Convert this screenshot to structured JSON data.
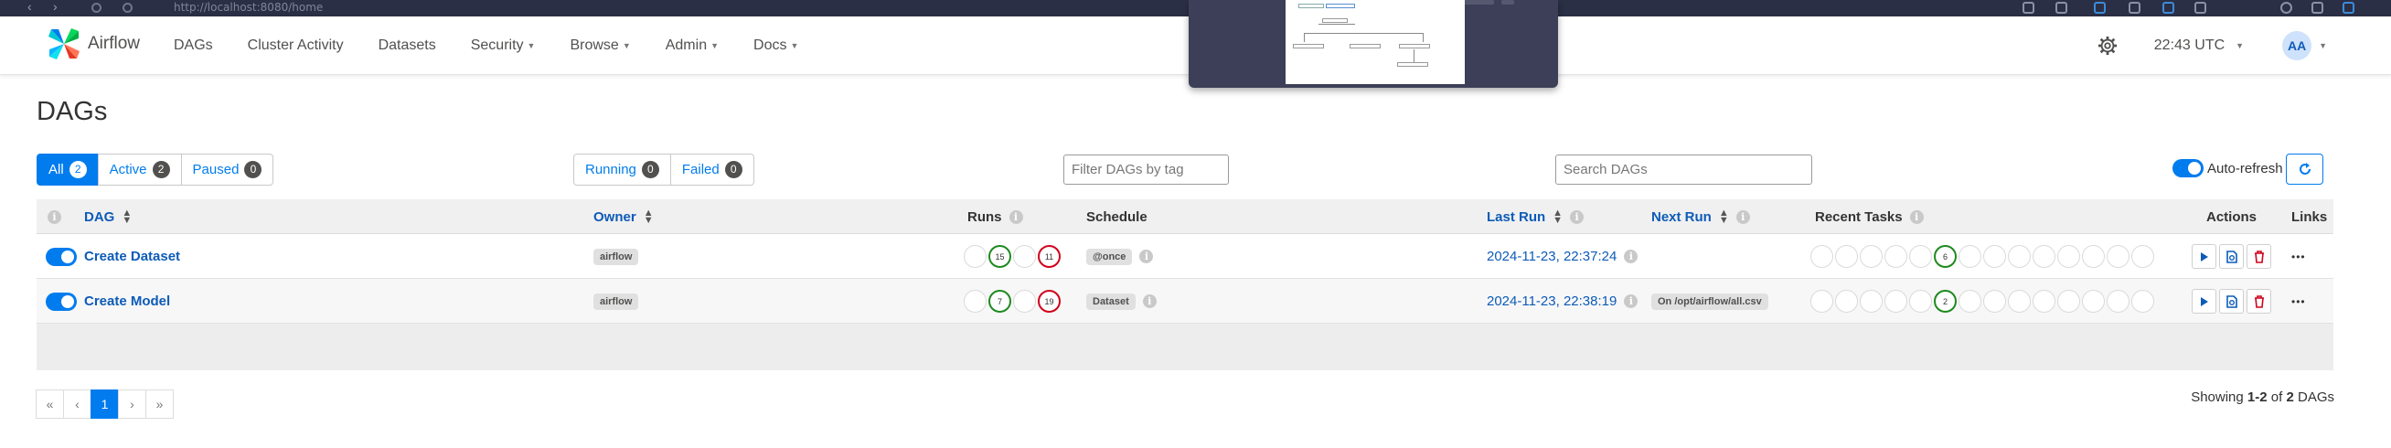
{
  "browser": {
    "url": "http://localhost:8080/home"
  },
  "brand": {
    "name": "Airflow"
  },
  "nav": {
    "items": [
      {
        "label": "DAGs",
        "dropdown": false
      },
      {
        "label": "Cluster Activity",
        "dropdown": false
      },
      {
        "label": "Datasets",
        "dropdown": false
      },
      {
        "label": "Security",
        "dropdown": true
      },
      {
        "label": "Browse",
        "dropdown": true
      },
      {
        "label": "Admin",
        "dropdown": true
      },
      {
        "label": "Docs",
        "dropdown": true
      }
    ],
    "time": "22:43 UTC",
    "avatar": "AA"
  },
  "page": {
    "title": "DAGs"
  },
  "status_filter": [
    {
      "label": "All",
      "count": "2",
      "active": true
    },
    {
      "label": "Active",
      "count": "2",
      "active": false
    },
    {
      "label": "Paused",
      "count": "0",
      "active": false
    }
  ],
  "run_filter": [
    {
      "label": "Running",
      "count": "0"
    },
    {
      "label": "Failed",
      "count": "0"
    }
  ],
  "tag_filter": {
    "placeholder": "Filter DAGs by tag"
  },
  "search": {
    "placeholder": "Search DAGs"
  },
  "auto_refresh": {
    "label": "Auto-refresh",
    "enabled": true
  },
  "table": {
    "headers": {
      "dag": "DAG",
      "owner": "Owner",
      "runs": "Runs",
      "schedule": "Schedule",
      "last_run": "Last Run",
      "next_run": "Next Run",
      "recent_tasks": "Recent Tasks",
      "actions": "Actions",
      "links": "Links"
    },
    "rows": [
      {
        "dag": "Create Dataset",
        "owner": "airflow",
        "runs_success": "15",
        "runs_failed": "11",
        "schedule": "@once",
        "last_run": "2024-11-23, 22:37:24",
        "next_run": "",
        "recent_success": "6"
      },
      {
        "dag": "Create Model",
        "owner": "airflow",
        "runs_success": "7",
        "runs_failed": "19",
        "schedule": "Dataset",
        "last_run": "2024-11-23, 22:38:19",
        "next_run": "On /opt/airflow/all.csv",
        "recent_success": "2"
      }
    ]
  },
  "pagination": {
    "first": "«",
    "prev": "‹",
    "current": "1",
    "next": "›",
    "last": "»"
  },
  "showing": {
    "prefix": "Showing",
    "range": "1-2",
    "of": "of",
    "total": "2",
    "suffix": "DAGs"
  },
  "colors": {
    "accent": "#017cee",
    "success": "#1f8a1f",
    "failed": "#d0021b",
    "link": "#0d5bb8"
  }
}
